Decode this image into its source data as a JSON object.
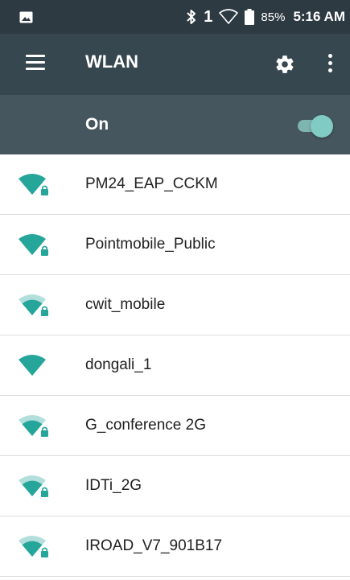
{
  "status_bar": {
    "sim_slot": "1",
    "battery": "85%",
    "time": "5:16 AM"
  },
  "toolbar": {
    "title": "WLAN"
  },
  "toggle": {
    "label": "On",
    "state": true
  },
  "colors": {
    "accent": "#26a69a",
    "toolbar": "#37474f",
    "status_bar": "#2e3a42",
    "on_bar": "#46565e"
  },
  "networks": [
    {
      "ssid": "PM24_EAP_CCKM",
      "signal": 4,
      "secured": true
    },
    {
      "ssid": "Pointmobile_Public",
      "signal": 4,
      "secured": true
    },
    {
      "ssid": "cwit_mobile",
      "signal": 3,
      "secured": true
    },
    {
      "ssid": "dongali_1",
      "signal": 4,
      "secured": false
    },
    {
      "ssid": "G_conference 2G",
      "signal": 3,
      "secured": true
    },
    {
      "ssid": "IDTi_2G",
      "signal": 3,
      "secured": true
    },
    {
      "ssid": "IROAD_V7_901B17",
      "signal": 3,
      "secured": true
    }
  ]
}
